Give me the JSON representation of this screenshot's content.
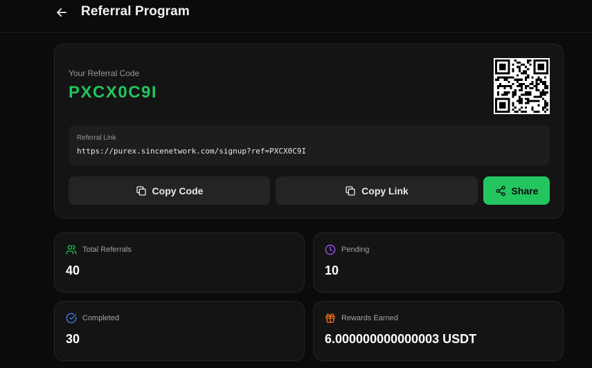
{
  "header": {
    "title": "Referral Program",
    "back_icon": "arrow-left-icon"
  },
  "referral": {
    "code_label": "Your Referral Code",
    "code": "PXCX0C9I",
    "code_color": "#22c55e",
    "qr_icon": "qr-code-icon",
    "link_label": "Referral Link",
    "link": "https://purex.sincenetwork.com/signup?ref=PXCX0C9I"
  },
  "actions": {
    "copy_code_label": "Copy Code",
    "copy_link_label": "Copy Link",
    "share_label": "Share",
    "share_color": "#22c55e"
  },
  "stats": {
    "total_referrals": {
      "label": "Total Referrals",
      "value": "40",
      "icon": "users-icon",
      "color": "#22c55e"
    },
    "pending": {
      "label": "Pending",
      "value": "10",
      "icon": "clock-icon",
      "color": "#a855f7"
    },
    "completed": {
      "label": "Completed",
      "value": "30",
      "icon": "check-circle-icon",
      "color": "#3b82f6"
    },
    "rewards_earned": {
      "label": "Rewards Earned",
      "value": "6.000000000000003 USDT",
      "icon": "gift-icon",
      "color": "#f97316"
    }
  }
}
